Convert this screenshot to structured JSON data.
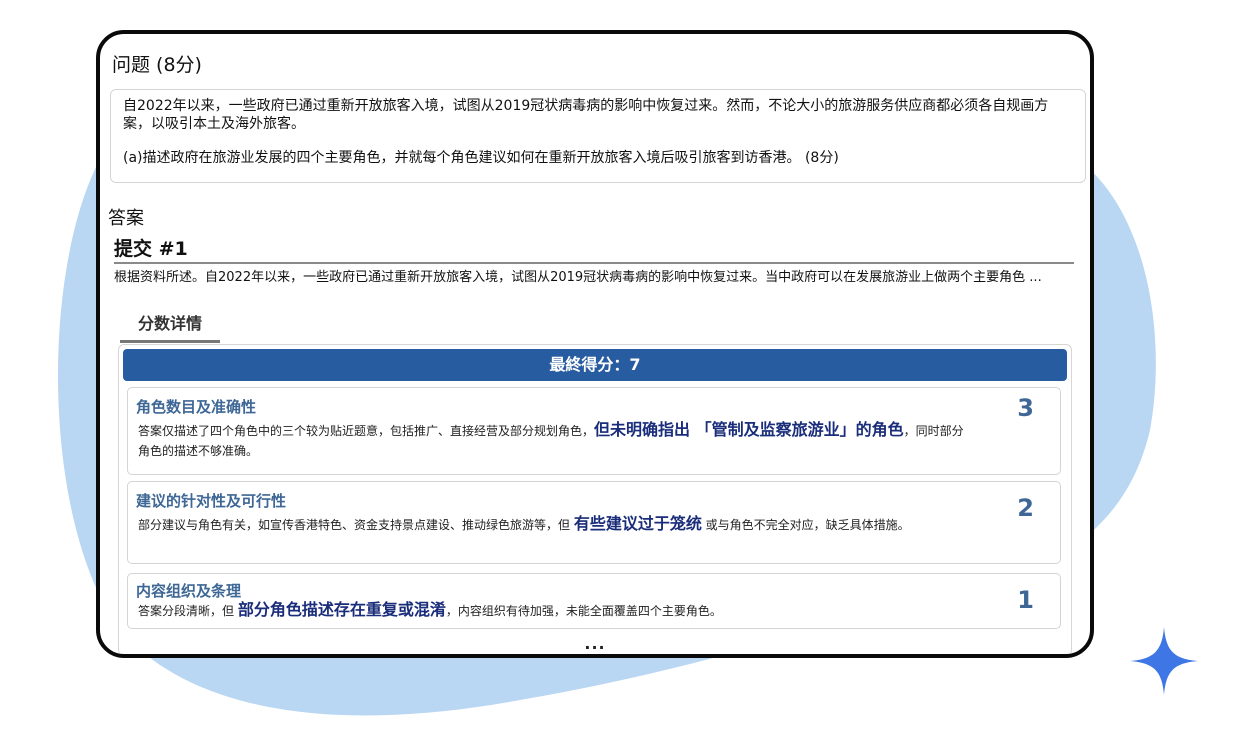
{
  "colors": {
    "accent": "#285ca0",
    "criteria_title": "#3e6796",
    "highlight": "#1a2d7a",
    "blob": "#b9d6f2",
    "star": "#3e76e6"
  },
  "question": {
    "title": "问题 (8分)",
    "paragraph": "自2022年以来，一些政府已通过重新开放旅客入境，试图从2019冠状病毒病的影响中恢复过来。然而，不论大小的旅游服务供应商都必须各自规画方案，以吸引本土及海外旅客。",
    "part_a": "(a)描述政府在旅游业发展的四个主要角色，并就每个角色建议如何在重新开放旅客入境后吸引旅客到访香港。 (8分)"
  },
  "answer": {
    "section_label": "答案",
    "submission_title": "提交 #1",
    "excerpt": "根据资料所述。自2022年以来，一些政府已通过重新开放旅客入境，试图从2019冠状病毒病的影响中恢复过来。当中政府可以在发展旅游业上做两个主要角色 ..."
  },
  "score_details": {
    "tab_label": "分数详情",
    "final_score": "最終得分：7",
    "criteria": [
      {
        "title": "角色数目及准确性",
        "score": "3",
        "desc_before": "答案仅描述了四个角色中的三个较为贴近题意，包括推广、直接经营及部分规划角色，",
        "desc_highlight": "但未明确指出 「管制及监察旅游业」的角色",
        "desc_after": "，同时部分角色的描述不够准确。"
      },
      {
        "title": "建议的针对性及可行性",
        "score": "2",
        "desc_before": "部分建议与角色有关，如宣传香港特色、资金支持景点建设、推动绿色旅游等，但 ",
        "desc_highlight": "有些建议过于笼统",
        "desc_after": " 或与角色不完全对应，缺乏具体措施。"
      },
      {
        "title": "内容组织及条理",
        "score": "1",
        "desc_before": "答案分段清晰，但 ",
        "desc_highlight": "部分角色描述存在重复或混淆",
        "desc_after": "，内容组织有待加强，未能全面覆盖四个主要角色。"
      }
    ],
    "more": "..."
  },
  "icons": {
    "sparkle": "sparkle-star-icon"
  }
}
